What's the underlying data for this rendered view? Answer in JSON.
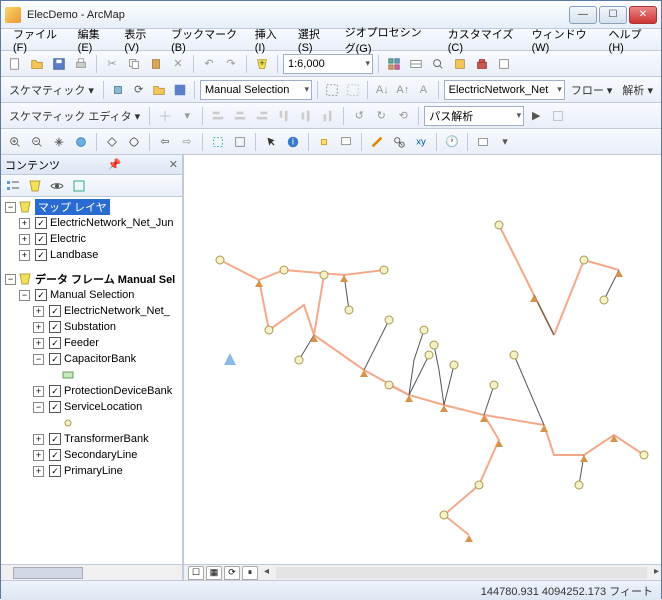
{
  "window": {
    "title": "ElecDemo - ArcMap"
  },
  "menu": {
    "items": [
      "ファイル(F)",
      "編集(E)",
      "表示(V)",
      "ブックマーク(B)",
      "挿入(I)",
      "選択(S)",
      "ジオプロセシング(G)",
      "カスタマイズ(C)",
      "ウィンドウ(W)",
      "ヘルプ(H)"
    ]
  },
  "tb1": {
    "scale": "1:6,000"
  },
  "tb2": {
    "schematic": "スケマティック ▾",
    "selection_mode": "Manual Selection",
    "network": "ElectricNetwork_Net",
    "flow": "フロー ▾",
    "analysis": "解析 ▾"
  },
  "tb3": {
    "editor": "スケマティック エディタ ▾",
    "analysis_type": "パス解析"
  },
  "toc": {
    "title": "コンテンツ",
    "layers_frame": "マップ レイヤ",
    "layers": [
      {
        "label": "ElectricNetwork_Net_Jun",
        "checked": true,
        "expand": "+"
      },
      {
        "label": "Electric",
        "checked": true,
        "expand": "+"
      },
      {
        "label": "Landbase",
        "checked": true,
        "expand": "+"
      }
    ],
    "manual_frame": "データ フレーム Manual Sel",
    "manual_root": "Manual Selection",
    "manual": [
      {
        "label": "ElectricNetwork_Net_",
        "checked": true
      },
      {
        "label": "Substation",
        "checked": true
      },
      {
        "label": "Feeder",
        "checked": true
      },
      {
        "label": "CapacitorBank",
        "checked": true,
        "expanded": true
      },
      {
        "label": "ProtectionDeviceBank",
        "checked": true
      },
      {
        "label": "ServiceLocation",
        "checked": true,
        "expanded": true
      },
      {
        "label": "TransformerBank",
        "checked": true
      },
      {
        "label": "SecondaryLine",
        "checked": true
      },
      {
        "label": "PrimaryLine",
        "checked": true
      }
    ]
  },
  "status": {
    "coords": "144780.931 4094252.173 フィート"
  }
}
